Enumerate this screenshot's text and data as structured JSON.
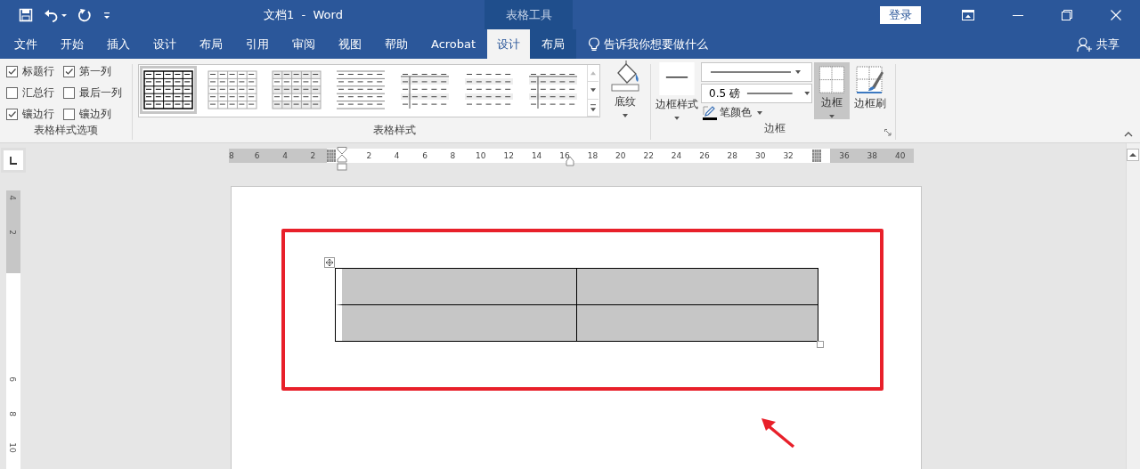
{
  "title_bar": {
    "title": "文档1  -  Word",
    "context_group": "表格工具",
    "login": "登录"
  },
  "tabs": [
    {
      "label": "文件",
      "selected": false,
      "kind": "normal"
    },
    {
      "label": "开始",
      "selected": false,
      "kind": "normal"
    },
    {
      "label": "插入",
      "selected": false,
      "kind": "normal"
    },
    {
      "label": "设计",
      "selected": false,
      "kind": "normal"
    },
    {
      "label": "布局",
      "selected": false,
      "kind": "normal"
    },
    {
      "label": "引用",
      "selected": false,
      "kind": "normal"
    },
    {
      "label": "审阅",
      "selected": false,
      "kind": "normal"
    },
    {
      "label": "视图",
      "selected": false,
      "kind": "normal"
    },
    {
      "label": "帮助",
      "selected": false,
      "kind": "normal"
    },
    {
      "label": "Acrobat",
      "selected": false,
      "kind": "normal"
    },
    {
      "label": "设计",
      "selected": true,
      "kind": "context"
    },
    {
      "label": "布局",
      "selected": false,
      "kind": "context"
    }
  ],
  "tell_me": "告诉我你想要做什么",
  "share": "共享",
  "style_options": {
    "label": "表格样式选项",
    "items": [
      {
        "label": "标题行",
        "checked": true
      },
      {
        "label": "第一列",
        "checked": true
      },
      {
        "label": "汇总行",
        "checked": false
      },
      {
        "label": "最后一列",
        "checked": false
      },
      {
        "label": "镶边行",
        "checked": true
      },
      {
        "label": "镶边列",
        "checked": false
      }
    ]
  },
  "table_styles": {
    "label": "表格样式",
    "items": [
      {
        "kind": "grid",
        "selected": true
      },
      {
        "kind": "grid-light",
        "selected": false
      },
      {
        "kind": "grid-banded",
        "selected": false
      },
      {
        "kind": "lines",
        "selected": false
      },
      {
        "kind": "list-column",
        "selected": false
      },
      {
        "kind": "plain",
        "selected": false
      },
      {
        "kind": "list-column",
        "selected": false
      }
    ]
  },
  "shading": "底纹",
  "borders": {
    "label": "边框",
    "border_styles": "边框样式",
    "pen_weight": "0.5 磅",
    "pen_color": "笔颜色",
    "borders_button": {
      "label": "边框",
      "selected": true
    },
    "border_painter": "边框刷"
  },
  "ruler": {
    "items": [
      {
        "kind": "number",
        "label": "8"
      },
      {
        "kind": "number",
        "label": "6"
      },
      {
        "kind": "number",
        "label": "4"
      },
      {
        "kind": "number",
        "label": "2"
      },
      {
        "kind": "margin"
      },
      {
        "kind": "number",
        "label": "2"
      },
      {
        "kind": "number",
        "label": "4"
      },
      {
        "kind": "number",
        "label": "6"
      },
      {
        "kind": "number",
        "label": "8"
      },
      {
        "kind": "number",
        "label": "10"
      },
      {
        "kind": "number",
        "label": "12"
      },
      {
        "kind": "number",
        "label": "14"
      },
      {
        "kind": "number",
        "label": "16"
      },
      {
        "kind": "number",
        "label": "18"
      },
      {
        "kind": "number",
        "label": "20"
      },
      {
        "kind": "number",
        "label": "22"
      },
      {
        "kind": "number",
        "label": "24"
      },
      {
        "kind": "number",
        "label": "26"
      },
      {
        "kind": "number",
        "label": "28"
      },
      {
        "kind": "number",
        "label": "30"
      },
      {
        "kind": "number",
        "label": "32"
      },
      {
        "kind": "margin"
      },
      {
        "kind": "number",
        "label": "36"
      },
      {
        "kind": "number",
        "label": "38"
      },
      {
        "kind": "number",
        "label": "40"
      }
    ]
  },
  "vertical_ruler": {
    "labels": [
      "4",
      "2",
      "6",
      "8",
      "10"
    ]
  },
  "table": {
    "shaded": true
  }
}
